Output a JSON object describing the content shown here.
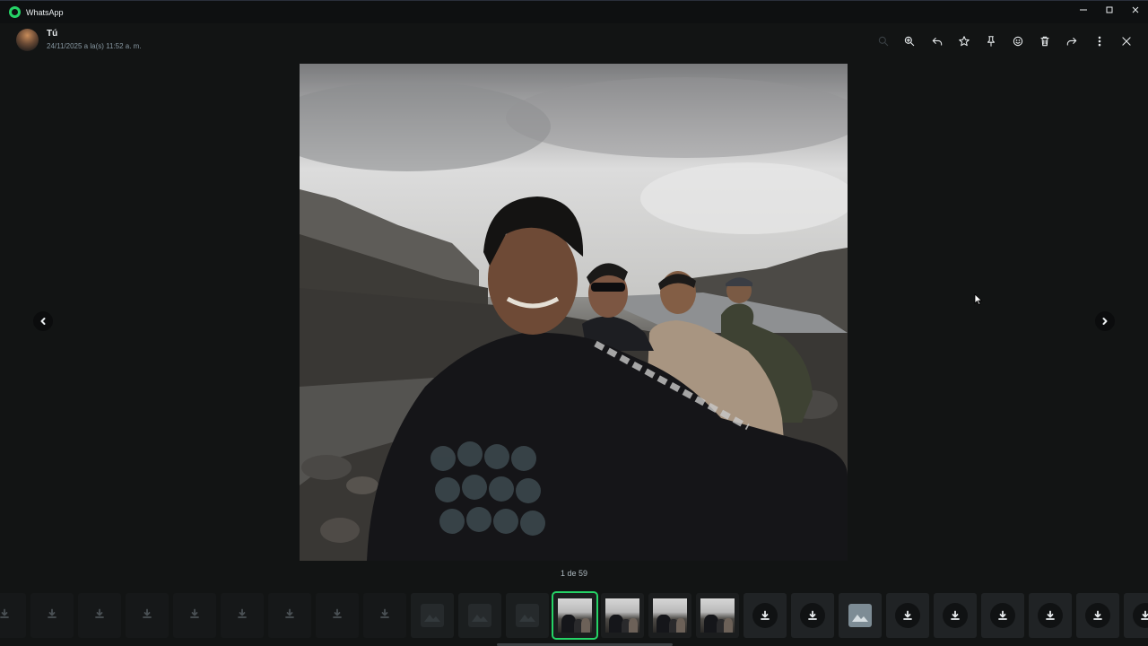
{
  "window": {
    "title": "WhatsApp",
    "controls": [
      "minimize-icon",
      "maximize-icon",
      "close-icon"
    ]
  },
  "header": {
    "sender_name": "Tú",
    "timestamp": "24/11/2025 a la(s) 11:52 a. m."
  },
  "toolbar": {
    "icons": [
      "search-icon",
      "zoom-in-icon",
      "reply-icon",
      "star-icon",
      "pin-icon",
      "emoji-icon",
      "delete-icon",
      "forward-icon",
      "more-icon",
      "close-icon"
    ]
  },
  "viewer": {
    "counter": "1 de 59",
    "prev_icon": "chevron-left-icon",
    "next_icon": "chevron-right-icon"
  },
  "accent_color": "#25d366",
  "thumbnails": [
    {
      "kind": "download-faint"
    },
    {
      "kind": "download-faint"
    },
    {
      "kind": "download-faint"
    },
    {
      "kind": "download-faint"
    },
    {
      "kind": "download-faint"
    },
    {
      "kind": "download-faint"
    },
    {
      "kind": "download-faint"
    },
    {
      "kind": "download-faint"
    },
    {
      "kind": "download-faint"
    },
    {
      "kind": "placeholder"
    },
    {
      "kind": "placeholder"
    },
    {
      "kind": "placeholder"
    },
    {
      "kind": "photo",
      "active": true
    },
    {
      "kind": "photo"
    },
    {
      "kind": "photo"
    },
    {
      "kind": "photo"
    },
    {
      "kind": "download"
    },
    {
      "kind": "download"
    },
    {
      "kind": "image-placeholder"
    },
    {
      "kind": "download"
    },
    {
      "kind": "download"
    },
    {
      "kind": "download"
    },
    {
      "kind": "download"
    },
    {
      "kind": "download"
    },
    {
      "kind": "download"
    }
  ]
}
